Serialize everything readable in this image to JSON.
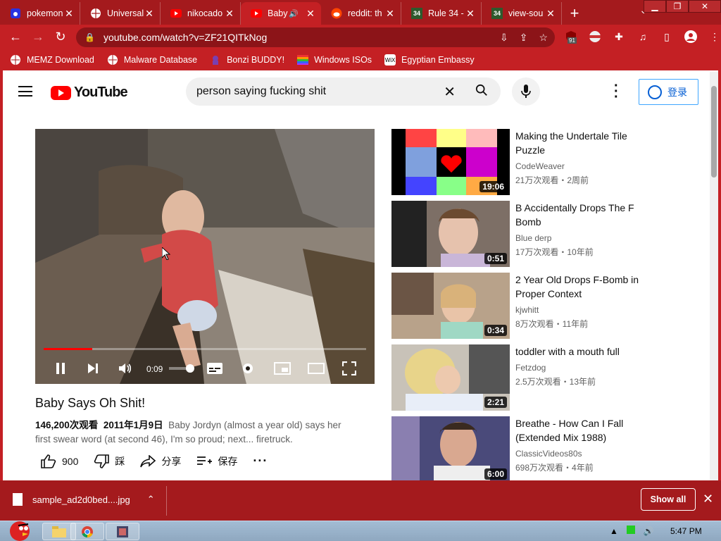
{
  "browser": {
    "tabs": [
      {
        "label": "pokemon",
        "icon": "baidu-icon",
        "active": false
      },
      {
        "label": "Universal",
        "icon": "globe-icon",
        "active": false
      },
      {
        "label": "nikocado",
        "icon": "youtube-icon",
        "active": false
      },
      {
        "label": "Baby",
        "icon": "youtube-icon",
        "active": true,
        "audio": true
      },
      {
        "label": "reddit: th",
        "icon": "reddit-icon",
        "active": false
      },
      {
        "label": "Rule 34 -",
        "icon": "rule34-icon",
        "active": false
      },
      {
        "label": "view-sou",
        "icon": "rule34-icon",
        "active": false
      }
    ],
    "url": "youtube.com/watch?v=ZF21QITkNog",
    "extension_badge": "91",
    "bookmarks": [
      {
        "label": "MEMZ Download",
        "icon": "globe-icon"
      },
      {
        "label": "Malware Database",
        "icon": "globe-icon"
      },
      {
        "label": "Bonzi BUDDY!",
        "icon": "bonzi-icon"
      },
      {
        "label": "Windows ISOs",
        "icon": "windows-icon"
      },
      {
        "label": "Egyptian Embassy",
        "icon": "wix-icon"
      }
    ],
    "theme_color": "#c42024"
  },
  "youtube": {
    "logo_text": "YouTube",
    "search_query": "person saying fucking shit",
    "signin_label": "登录",
    "player": {
      "time": "0:09",
      "progress": 0.15
    },
    "video": {
      "title": "Baby Says Oh Shit!",
      "views": "146,200次观看",
      "date": "2011年1月9日",
      "description_line1": "Baby Jordyn (almost a year old) says her",
      "description_line2": "first swear word (at second 46), I'm so proud; next... firetruck.",
      "likes": "900",
      "dislike_label": "踩",
      "share_label": "分享",
      "save_label": "保存"
    },
    "related": [
      {
        "title": "Making the Undertale Tile Puzzle",
        "channel": "CodeWeaver",
        "stats": "21万次观看・2周前",
        "duration": "19:06"
      },
      {
        "title": "B Accidentally Drops The F Bomb",
        "channel": "Blue derp",
        "stats": "17万次观看・10年前",
        "duration": "0:51"
      },
      {
        "title": "2 Year Old Drops F-Bomb in Proper Context",
        "channel": "kjwhitt",
        "stats": "8万次观看・11年前",
        "duration": "0:34"
      },
      {
        "title": "toddler with a mouth full",
        "channel": "Fetzdog",
        "stats": "2.5万次观看・13年前",
        "duration": "2:21"
      },
      {
        "title": "Breathe - How Can I Fall (Extended Mix 1988)",
        "channel": "ClassicVideos80s",
        "stats": "698万次观看・4年前",
        "duration": "6:00"
      }
    ]
  },
  "download": {
    "filename": "sample_ad2d0bed....jpg",
    "show_all": "Show all"
  },
  "taskbar": {
    "clock": "5:47 PM"
  }
}
